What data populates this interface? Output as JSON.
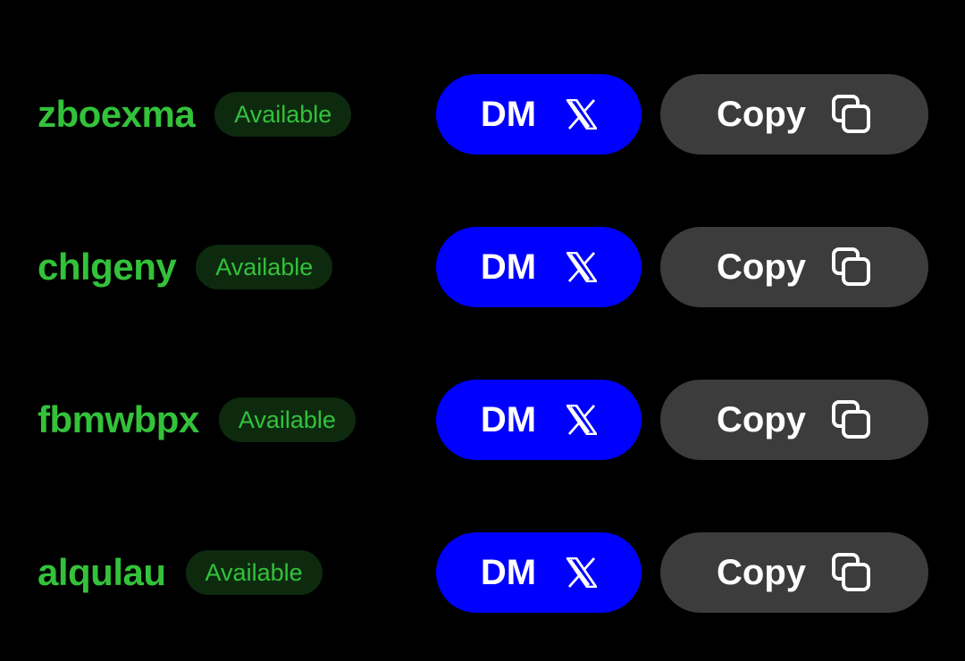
{
  "colors": {
    "background": "#000000",
    "username": "#33c23a",
    "badge_text": "#33c23a",
    "badge_background": "#0d2a0f",
    "dm_button": "#0000ff",
    "copy_button": "#3c3c3c",
    "button_text": "#ffffff"
  },
  "icons": {
    "dm": "x-logo-icon",
    "copy": "copy-icon"
  },
  "rows": [
    {
      "username": "zboexma",
      "status": "Available",
      "dm_label": "DM",
      "copy_label": "Copy"
    },
    {
      "username": "chlgeny",
      "status": "Available",
      "dm_label": "DM",
      "copy_label": "Copy"
    },
    {
      "username": "fbmwbpx",
      "status": "Available",
      "dm_label": "DM",
      "copy_label": "Copy"
    },
    {
      "username": "alqulau",
      "status": "Available",
      "dm_label": "DM",
      "copy_label": "Copy"
    }
  ]
}
